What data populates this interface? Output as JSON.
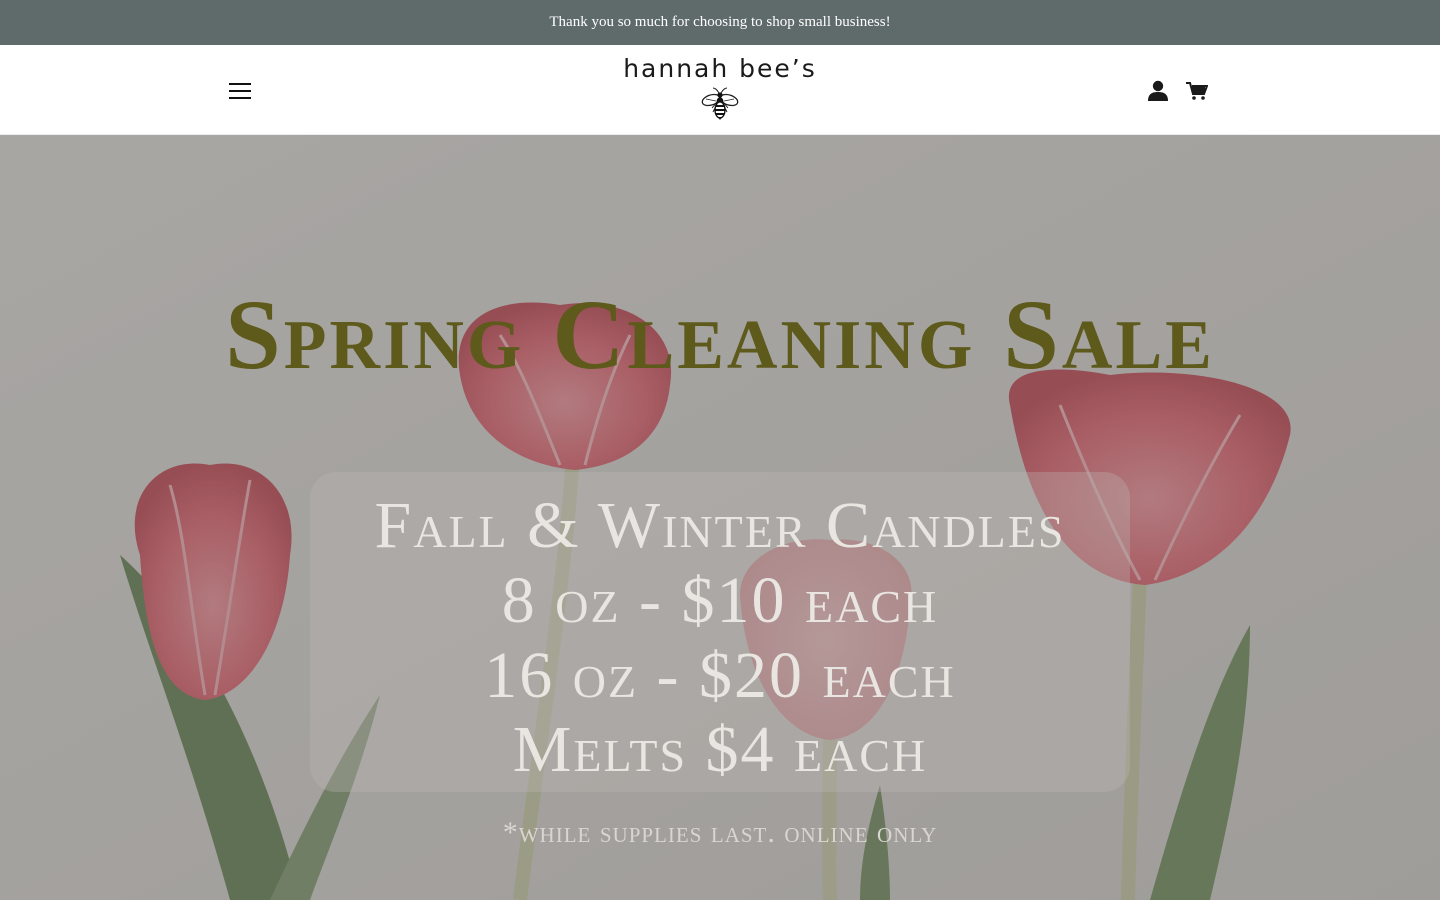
{
  "announcement": {
    "text": "Thank you so much for choosing to shop small business!"
  },
  "header": {
    "logo_text": "hannah bee’s",
    "menu_icon": "hamburger-icon",
    "account_icon": "user-icon",
    "cart_icon": "cart-icon"
  },
  "hero": {
    "title": "Spring Cleaning Sale",
    "lines": [
      "Fall & Winter Candles",
      "8 oz - $10 each",
      "16 oz - $20 each",
      "Melts $4 each"
    ],
    "disclaimer": "*while supplies last. online only"
  },
  "colors": {
    "announcement_bg": "#5f6a6a",
    "title_olive": "#5d5a1c",
    "tulip_pink": "#e8707a"
  }
}
